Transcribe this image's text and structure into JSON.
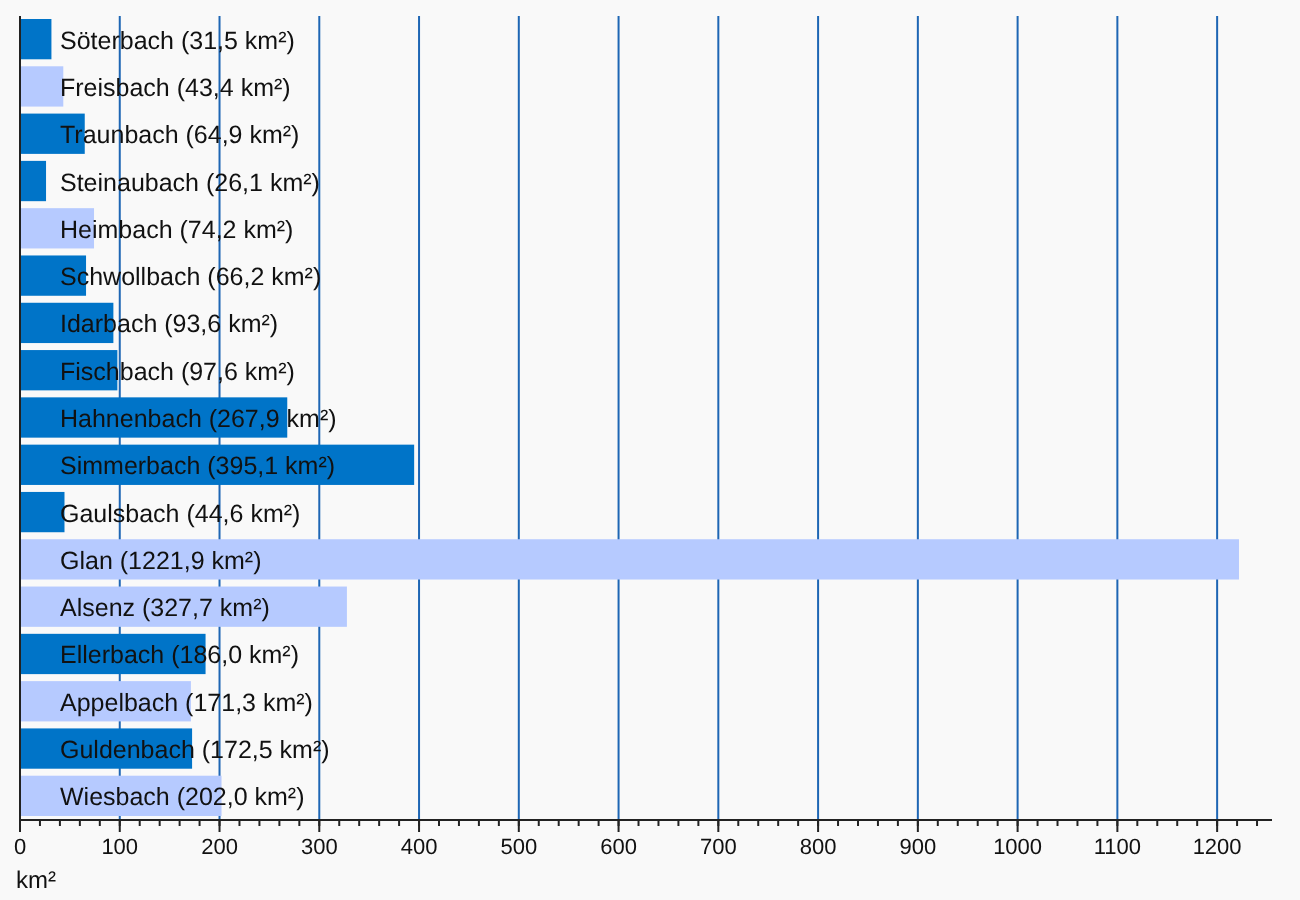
{
  "chart_data": {
    "type": "bar",
    "grid": true,
    "orientation": "horizontal",
    "stacked": true,
    "xlabel": "km²",
    "xlim": [
      0,
      1255
    ],
    "xticks": [
      0,
      100,
      200,
      300,
      400,
      500,
      600,
      700,
      800,
      900,
      1000,
      1100,
      1200
    ],
    "categories": [
      "Söterbach (31,5 km²)",
      "Freisbach (43,4 km²)",
      "Traunbach (64,9 km²)",
      "Steinaubach (26,1 km²)",
      "Heimbach (74,2 km²)",
      "Schwollbach (66,2 km²)",
      "Idarbach (93,6 km²)",
      "Fischbach (97,6 km²)",
      "Hahnenbach (267,9 km²)",
      "Simmerbach (395,1 km²)",
      "Gaulsbach (44,6 km²)",
      "Glan (1221,9 km²)",
      "Alsenz (327,7 km²)",
      "Ellerbach (186,0 km²)",
      "Appelbach (171,3 km²)",
      "Guldenbach (172,5 km²)",
      "Wiesbach (202,0 km²)"
    ],
    "series": [
      {
        "color": "#0074c8",
        "values": [
          31.5,
          null,
          64.9,
          26.1,
          null,
          66.2,
          93.6,
          97.6,
          267.9,
          395.1,
          44.6,
          null,
          null,
          186.0,
          null,
          172.5,
          null
        ]
      },
      {
        "color": "#b6caff",
        "values": [
          null,
          43.4,
          null,
          null,
          74.2,
          null,
          null,
          null,
          null,
          null,
          null,
          1221.9,
          327.7,
          null,
          171.3,
          null,
          202.0
        ]
      }
    ]
  }
}
